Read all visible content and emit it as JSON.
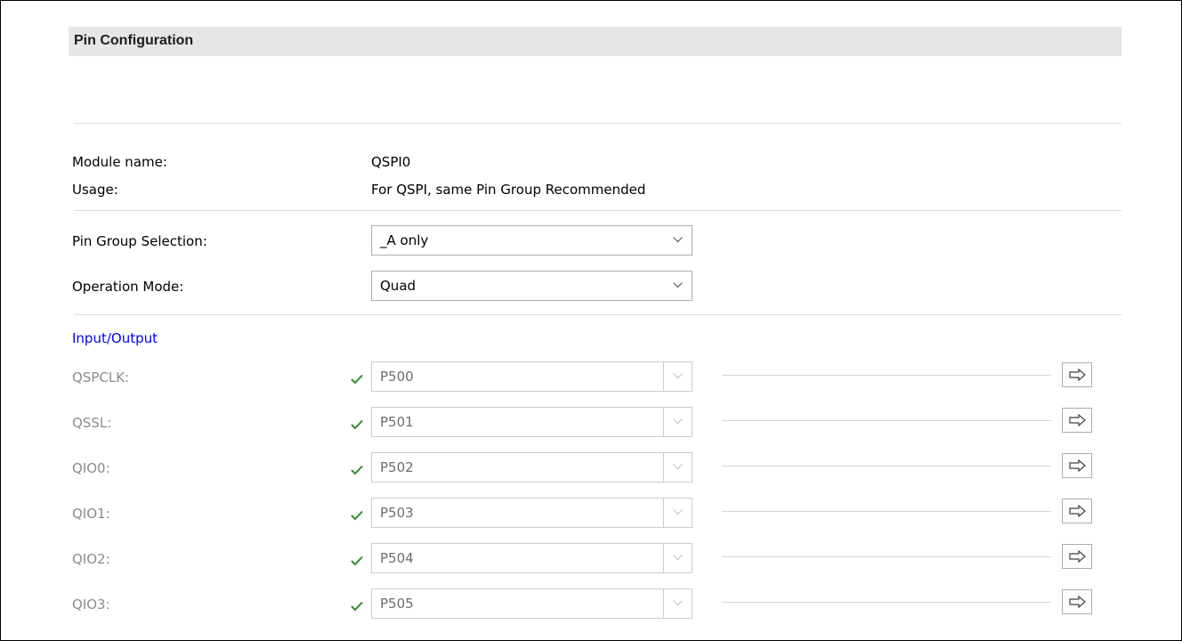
{
  "section": {
    "title": "Pin Configuration"
  },
  "info": {
    "module_label": "Module name:",
    "module_value": "QSPI0",
    "usage_label": "Usage:",
    "usage_value": "For QSPI, same Pin Group Recommended"
  },
  "settings": {
    "pin_group_label": "Pin Group Selection:",
    "pin_group_value": "_A only",
    "operation_mode_label": "Operation Mode:",
    "operation_mode_value": "Quad"
  },
  "io": {
    "header": "Input/Output",
    "pins": [
      {
        "label": "QSPCLK:",
        "value": "P500"
      },
      {
        "label": "QSSL:",
        "value": "P501"
      },
      {
        "label": "QIO0:",
        "value": "P502"
      },
      {
        "label": "QIO1:",
        "value": "P503"
      },
      {
        "label": "QIO2:",
        "value": "P504"
      },
      {
        "label": "QIO3:",
        "value": "P505"
      }
    ]
  },
  "colors": {
    "check": "#2e8b2e",
    "link": "#0000ee",
    "disabled_text": "#8c8c8c",
    "header_bg": "#e6e6e6"
  },
  "icons": {
    "dropdown": "chevron-down-icon",
    "valid": "checkmark-icon",
    "navigate": "arrow-right-icon"
  }
}
